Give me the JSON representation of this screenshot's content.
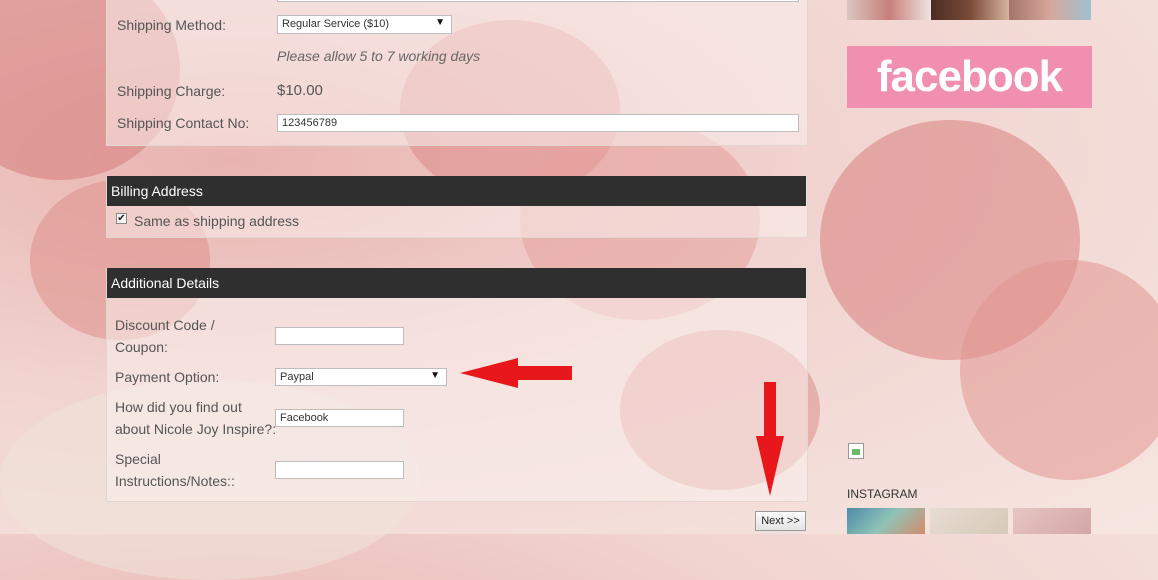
{
  "shipping": {
    "method_label": "Shipping Method:",
    "method_value": "Regular Service ($10)",
    "allow_note": "Please allow 5 to 7 working days",
    "charge_label": "Shipping Charge:",
    "charge_value": "$10.00",
    "contact_label": "Shipping Contact No:",
    "contact_value": "123456789"
  },
  "billing": {
    "title": "Billing Address",
    "same_as_shipping_label": "Same as shipping address",
    "same_as_shipping_checked": true
  },
  "additional": {
    "title": "Additional Details",
    "discount_label_1": "Discount Code /",
    "discount_label_2": "Coupon:",
    "discount_value": "",
    "payment_label": "Payment Option:",
    "payment_value": "Paypal",
    "find_label_1": "How did you find out",
    "find_label_2": "about Nicole Joy Inspire?:",
    "find_value": "Facebook",
    "special_label_1": "Special",
    "special_label_2": "Instructions/Notes::",
    "special_value": ""
  },
  "next_button": "Next >>",
  "sidebar": {
    "facebook_text": "facebook",
    "instagram_heading": "INSTAGRAM"
  },
  "colors": {
    "header_bg": "#2f2f2f",
    "facebook_bg": "#f08fb0",
    "annotation_red": "#e8171b"
  }
}
